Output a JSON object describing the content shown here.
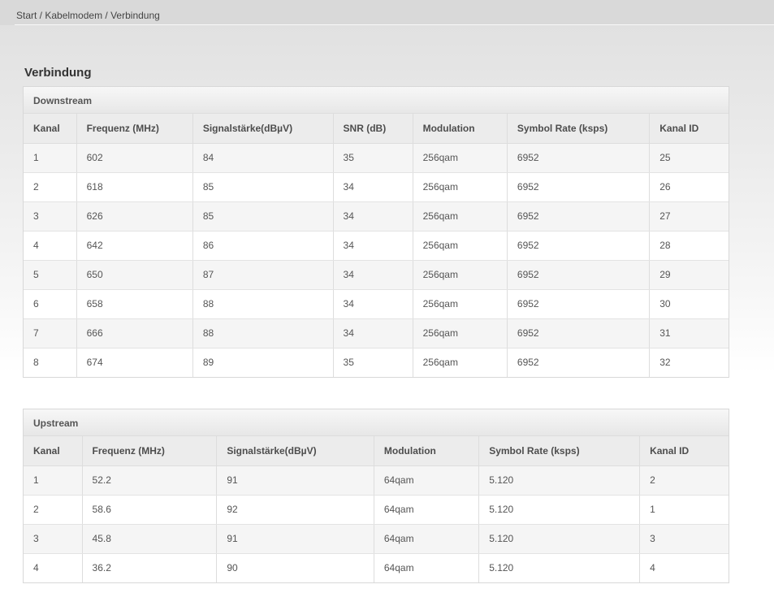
{
  "breadcrumb": {
    "items": [
      "Start",
      "Kabelmodem",
      "Verbindung"
    ],
    "separator": " / "
  },
  "page": {
    "title": "Verbindung"
  },
  "downstream": {
    "section_title": "Downstream",
    "columns": [
      "Kanal",
      "Frequenz (MHz)",
      "Signalstärke(dBµV)",
      "SNR (dB)",
      "Modulation",
      "Symbol Rate (ksps)",
      "Kanal ID"
    ],
    "rows": [
      [
        "1",
        "602",
        "84",
        "35",
        "256qam",
        "6952",
        "25"
      ],
      [
        "2",
        "618",
        "85",
        "34",
        "256qam",
        "6952",
        "26"
      ],
      [
        "3",
        "626",
        "85",
        "34",
        "256qam",
        "6952",
        "27"
      ],
      [
        "4",
        "642",
        "86",
        "34",
        "256qam",
        "6952",
        "28"
      ],
      [
        "5",
        "650",
        "87",
        "34",
        "256qam",
        "6952",
        "29"
      ],
      [
        "6",
        "658",
        "88",
        "34",
        "256qam",
        "6952",
        "30"
      ],
      [
        "7",
        "666",
        "88",
        "34",
        "256qam",
        "6952",
        "31"
      ],
      [
        "8",
        "674",
        "89",
        "35",
        "256qam",
        "6952",
        "32"
      ]
    ]
  },
  "upstream": {
    "section_title": "Upstream",
    "columns": [
      "Kanal",
      "Frequenz (MHz)",
      "Signalstärke(dBµV)",
      "Modulation",
      "Symbol Rate (ksps)",
      "Kanal ID"
    ],
    "rows": [
      [
        "1",
        "52.2",
        "91",
        "64qam",
        "5.120",
        "2"
      ],
      [
        "2",
        "58.6",
        "92",
        "64qam",
        "5.120",
        "1"
      ],
      [
        "3",
        "45.8",
        "91",
        "64qam",
        "5.120",
        "3"
      ],
      [
        "4",
        "36.2",
        "90",
        "64qam",
        "5.120",
        "4"
      ]
    ]
  },
  "colors": {
    "breadcrumb_bar": "#d9d9d9",
    "page_gradient_top": "#e1e1e1",
    "panel_border": "#d8d8d8",
    "header_row_bg": "#ececec",
    "row_stripe": "#f5f5f5",
    "text": "#555555"
  }
}
